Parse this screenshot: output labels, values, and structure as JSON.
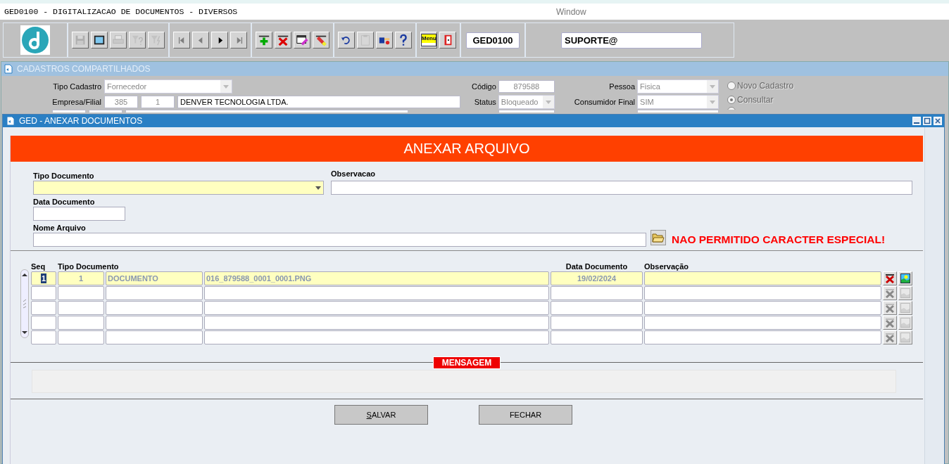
{
  "window": {
    "title": "GED0100 - DIGITALIZACAO DE DOCUMENTOS - DIVERSOS",
    "menu": "Window"
  },
  "toolbar": {
    "groups": [
      [
        {
          "kind": "save",
          "disabled": true
        },
        {
          "kind": "window",
          "disabled": false
        },
        {
          "kind": "print",
          "disabled": true
        },
        {
          "kind": "query",
          "disabled": true
        },
        {
          "kind": "execute",
          "disabled": true
        }
      ],
      [
        {
          "kind": "first",
          "disabled": true
        },
        {
          "kind": "prev",
          "disabled": true
        },
        {
          "kind": "next",
          "disabled": false
        },
        {
          "kind": "last",
          "disabled": true
        }
      ],
      [
        {
          "kind": "insert",
          "disabled": false
        },
        {
          "kind": "delete",
          "disabled": false
        },
        {
          "kind": "edit",
          "disabled": false
        },
        {
          "kind": "erase",
          "disabled": false
        }
      ],
      [
        {
          "kind": "undo",
          "disabled": false
        },
        {
          "kind": "clipboard",
          "disabled": true
        },
        {
          "kind": "point",
          "disabled": false
        },
        {
          "kind": "help",
          "disabled": false
        }
      ],
      [
        {
          "kind": "menu",
          "label": "Menu",
          "disabled": false
        },
        {
          "kind": "exit",
          "disabled": false
        }
      ]
    ],
    "form_code": "GED0100",
    "user": "SUPORTE@"
  },
  "background_form": {
    "title": "CADASTROS COMPARTILHADOS",
    "tipo_cadastro": {
      "label": "Tipo Cadastro",
      "value": "Fornecedor"
    },
    "empresa_filial": {
      "label": "Empresa/Filial",
      "empresa": "385",
      "filial": "1",
      "nome": "DENVER TECNOLOGIA LTDA."
    },
    "codigo": {
      "label": "Código",
      "value": "879588"
    },
    "status": {
      "label": "Status",
      "value": "Bloqueado"
    },
    "pessoa": {
      "label": "Pessoa",
      "value": "Fisica"
    },
    "consumidor_final": {
      "label": "Consumidor Final",
      "value": "SIM"
    },
    "modes": [
      {
        "label": "Novo Cadastro",
        "selected": false
      },
      {
        "label": "Consultar",
        "selected": true
      }
    ]
  },
  "dialog": {
    "title": "GED - ANEXAR DOCUMENTOS",
    "heading": "ANEXAR ARQUIVO",
    "tipo_documento": {
      "label": "Tipo Documento"
    },
    "observacao": {
      "label": "Observacao"
    },
    "data_documento": {
      "label": "Data Documento"
    },
    "nome_arquivo": {
      "label": "Nome Arquivo"
    },
    "warning": "NAO PERMITIDO CARACTER ESPECIAL!",
    "table": {
      "columns": [
        {
          "label": "Seq"
        },
        {
          "label": "Tipo Documento"
        },
        {
          "label": "Data Documento"
        },
        {
          "label": "Observação"
        }
      ],
      "rows": [
        {
          "current": true,
          "seq": "1",
          "tipo_codigo": "1",
          "tipo_nome": "DOCUMENTO",
          "arquivo": "016_879588_0001_0001.PNG",
          "data": "19/02/2024"
        },
        {
          "current": false
        },
        {
          "current": false
        },
        {
          "current": false
        },
        {
          "current": false
        }
      ]
    },
    "message_label": "MENSAGEM",
    "buttons": [
      {
        "label": "SALVAR",
        "mnemonic": true
      },
      {
        "label": "FECHAR",
        "mnemonic": false
      }
    ]
  }
}
